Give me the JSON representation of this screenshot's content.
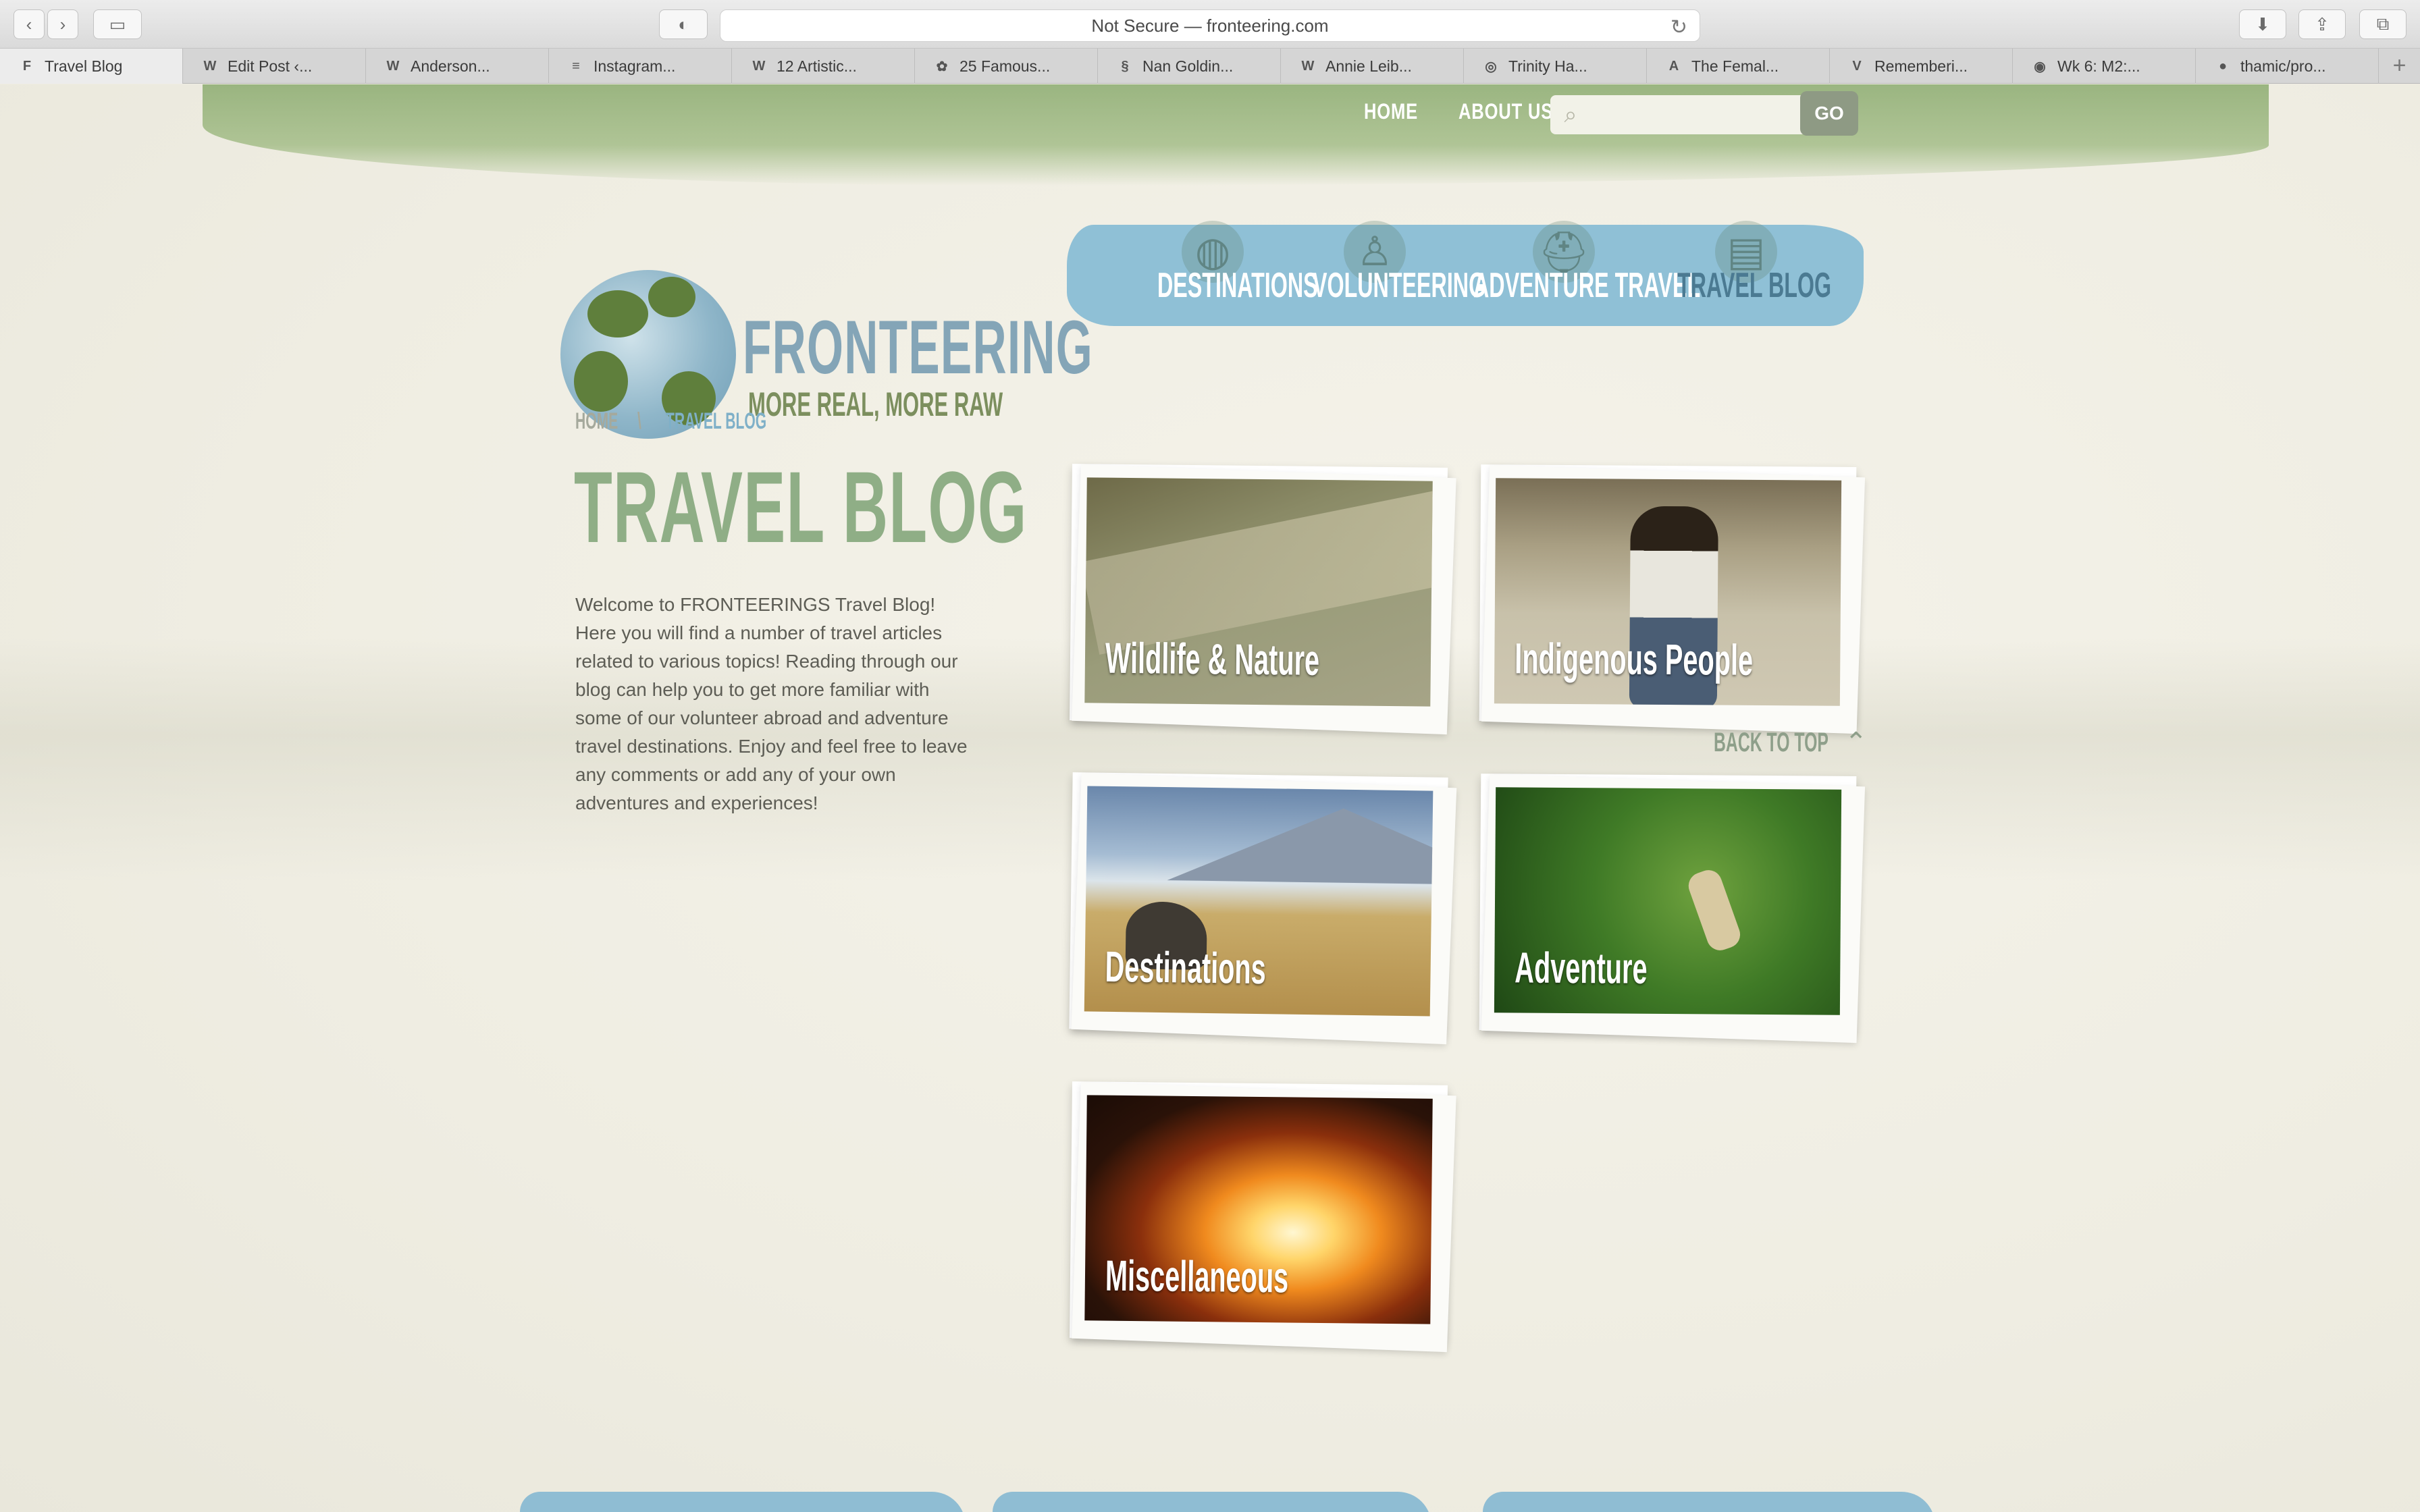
{
  "browser": {
    "address": "Not Secure — fronteering.com",
    "tabs": [
      {
        "label": "Travel Blog",
        "icon": "F"
      },
      {
        "label": "Edit Post ‹...",
        "icon": "W"
      },
      {
        "label": "Anderson...",
        "icon": "W"
      },
      {
        "label": "Instagram...",
        "icon": "≡"
      },
      {
        "label": "12 Artistic...",
        "icon": "W"
      },
      {
        "label": "25 Famous...",
        "icon": "✿"
      },
      {
        "label": "Nan Goldin...",
        "icon": "§"
      },
      {
        "label": "Annie Leib...",
        "icon": "W"
      },
      {
        "label": "Trinity Ha...",
        "icon": "◎"
      },
      {
        "label": "The Femal...",
        "icon": "A"
      },
      {
        "label": "Rememberi...",
        "icon": "V"
      },
      {
        "label": "Wk 6: M2:...",
        "icon": "◉"
      },
      {
        "label": "thamic/pro...",
        "icon": "●"
      }
    ]
  },
  "site": {
    "top_nav": {
      "home": "HOME",
      "about": "ABOUT US",
      "search_placeholder": "",
      "go": "GO"
    },
    "logo": {
      "title": "FRONTEERING",
      "tagline": "MORE REAL, MORE RAW"
    },
    "main_nav": [
      {
        "label": "DESTINATIONS",
        "icon": "globe-icon"
      },
      {
        "label": "VOLUNTEERING",
        "icon": "person-icon"
      },
      {
        "label": "ADVENTURE TRAVEL",
        "icon": "backpack-icon"
      },
      {
        "label": "TRAVEL BLOG",
        "icon": "passport-icon"
      }
    ],
    "breadcrumb": {
      "home": "HOME",
      "sep": "\\",
      "current": "TRAVEL BLOG"
    },
    "page_title": "TRAVEL BLOG",
    "intro": "Welcome to FRONTEERINGS Travel Blog! Here you will find a number of travel articles related to various topics! Reading through our blog can help you to get more familiar with some of our volunteer abroad and adventure travel destinations. Enjoy and feel free to leave any comments or add any of your own adventures and experiences!",
    "categories": [
      {
        "label": "Wildlife & Nature"
      },
      {
        "label": "Indigenous People"
      },
      {
        "label": "Destinations"
      },
      {
        "label": "Adventure"
      },
      {
        "label": "Miscellaneous"
      }
    ],
    "back_to_top": "BACK TO TOP"
  }
}
